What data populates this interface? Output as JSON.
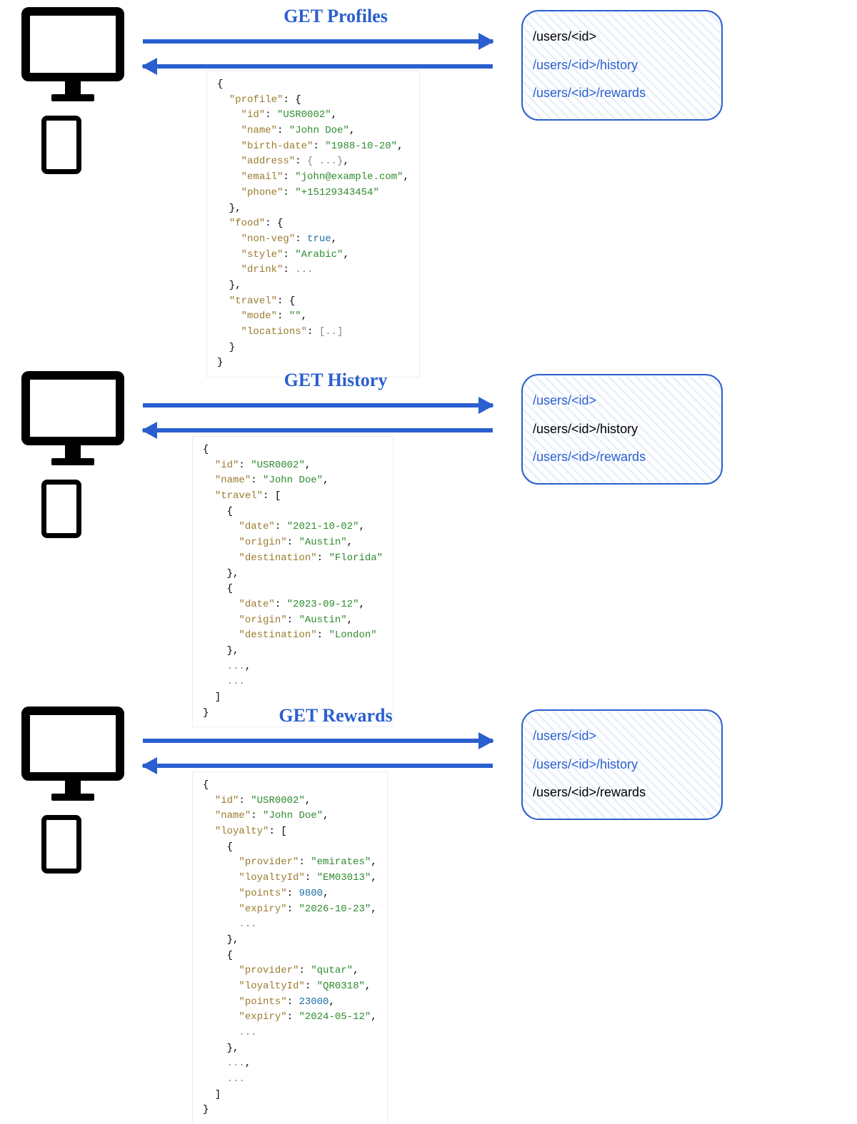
{
  "colors": {
    "accent": "#2a5fcf"
  },
  "endpoints": {
    "profiles": "/users/<id>",
    "history": "/users/<id>/history",
    "rewards": "/users/<id>/rewards"
  },
  "sections": [
    {
      "label": "GET Profiles",
      "active": "profiles",
      "json": {
        "profile": {
          "id": "USR0002",
          "name": "John Doe",
          "birth-date": "1988-10-20",
          "address": "{ ...}",
          "email": "john@example.com",
          "phone": "+15129343454"
        },
        "food": {
          "non-veg": true,
          "style": "Arabic",
          "drink": "..."
        },
        "travel": {
          "mode": "",
          "locations": "[..]"
        }
      }
    },
    {
      "label": "GET History",
      "active": "history",
      "json": {
        "id": "USR0002",
        "name": "John Doe",
        "travel": [
          {
            "date": "2021-10-02",
            "origin": "Austin",
            "destination": "Florida"
          },
          {
            "date": "2023-09-12",
            "origin": "Austin",
            "destination": "London"
          },
          "...",
          "..."
        ]
      }
    },
    {
      "label": "GET Rewards",
      "active": "rewards",
      "json": {
        "id": "USR0002",
        "name": "John Doe",
        "loyalty": [
          {
            "provider": "emirates",
            "loyaltyId": "EM03013",
            "points": 9800,
            "expiry": "2026-10-23",
            "_trail": "..."
          },
          {
            "provider": "qutar",
            "loyaltyId": "QR0318",
            "points": 23000,
            "expiry": "2024-05-12",
            "_trail": "..."
          },
          "...",
          "..."
        ]
      }
    }
  ]
}
